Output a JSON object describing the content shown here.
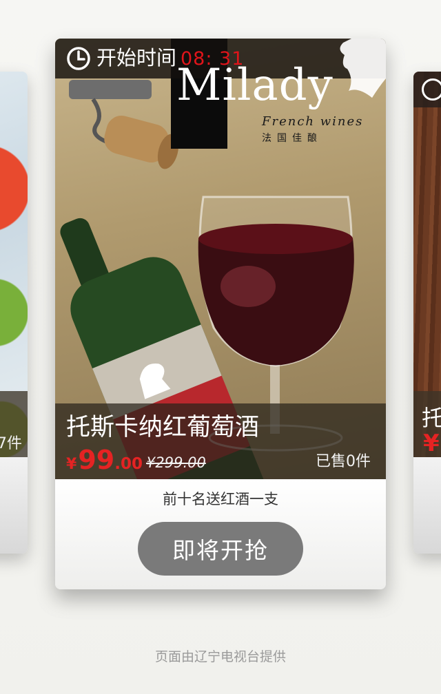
{
  "card": {
    "start_label": "开始时间",
    "start_time": "08: 31",
    "brand_logo": "Milady",
    "brand_sub": "French wines",
    "brand_sub_cn": "法国佳酿",
    "product_title": "托斯卡纳红葡萄酒",
    "price_symbol": "¥",
    "price_integer": "99",
    "price_decimal": ".00",
    "original_price": "¥299.00",
    "sold": "已售0件",
    "promo": "前十名送红酒一支",
    "cta_label": "即将开抢"
  },
  "side_left": {
    "sold": "7件"
  },
  "side_right": {
    "title": "托",
    "price_symbol": "¥"
  },
  "footer": "页面由辽宁电视台提供",
  "colors": {
    "accent_red": "#e52323",
    "time_red": "#e0141a",
    "cta_gray": "#7a7a7a"
  },
  "icons": {
    "clock": "clock-icon",
    "silhouette": "woman-silhouette-icon"
  }
}
